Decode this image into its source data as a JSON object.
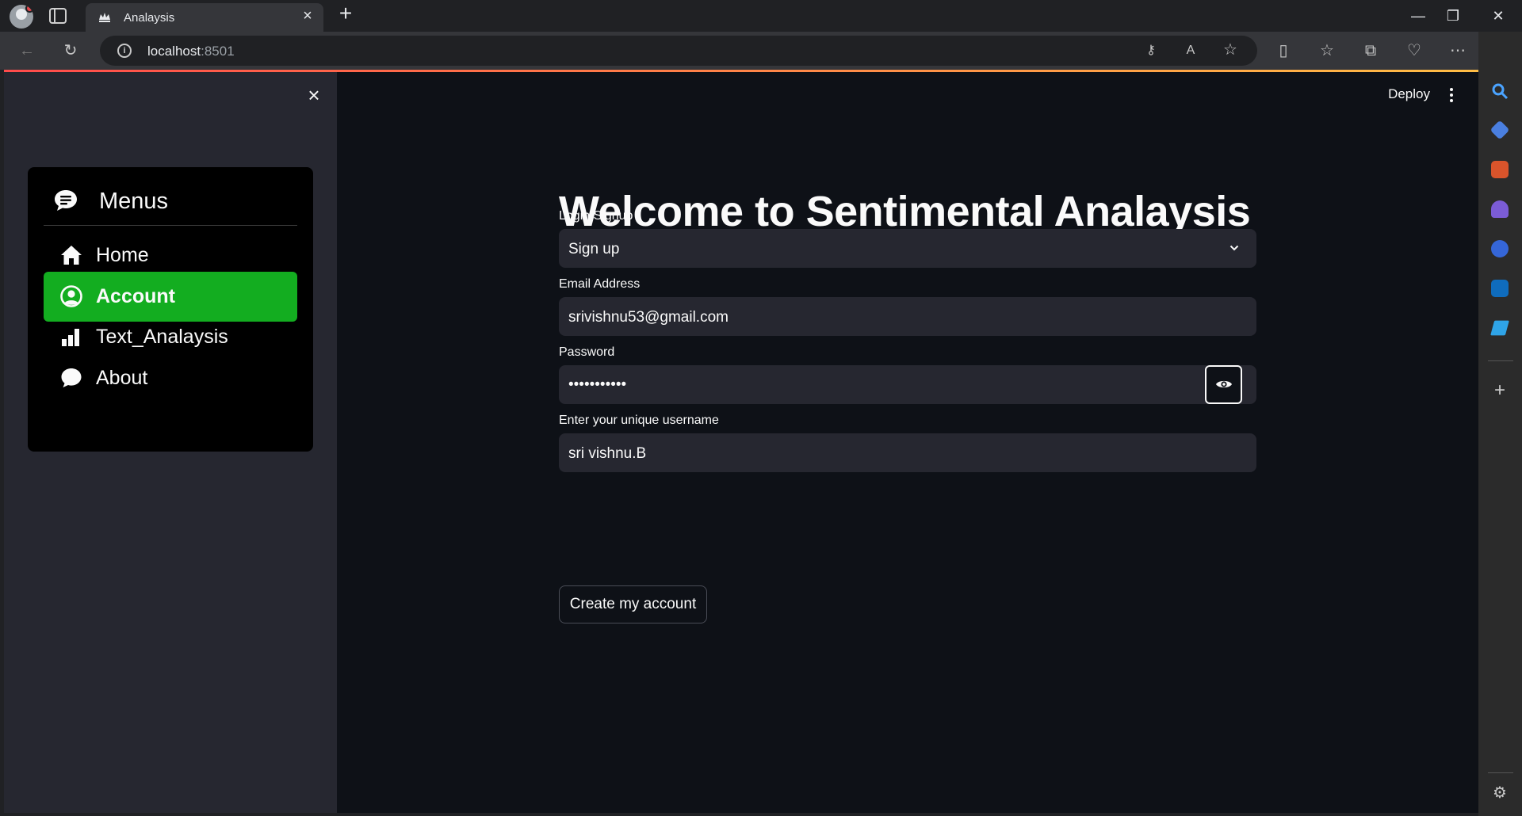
{
  "browser": {
    "tab_title": "Analaysis",
    "address_host": "localhost",
    "address_port": ":8501"
  },
  "sidebar": {
    "menu_title": "Menus",
    "items": [
      {
        "label": "Home",
        "icon": "house-icon",
        "active": false
      },
      {
        "label": "Account",
        "icon": "person-circle-icon",
        "active": true
      },
      {
        "label": "Text_Analaysis",
        "icon": "bar-chart-icon",
        "active": false
      },
      {
        "label": "About",
        "icon": "chat-bubble-icon",
        "active": false
      }
    ]
  },
  "header": {
    "deploy_label": "Deploy"
  },
  "main": {
    "title": "Welcome to Sentimental Analaysis",
    "login_signup": {
      "label": "Login/Signup",
      "value": "Sign up"
    },
    "email": {
      "label": "Email Address",
      "value": "srivishnu53@gmail.com"
    },
    "password": {
      "label": "Password",
      "masked_value": "•••••••••••"
    },
    "username": {
      "label": "Enter your unique username",
      "value": "sri vishnu.B"
    },
    "create_button": "Create my account"
  },
  "colors": {
    "accent_active": "#13ad20",
    "app_background": "#0e1117",
    "sidebar_background": "#262730",
    "input_background": "#262730"
  }
}
